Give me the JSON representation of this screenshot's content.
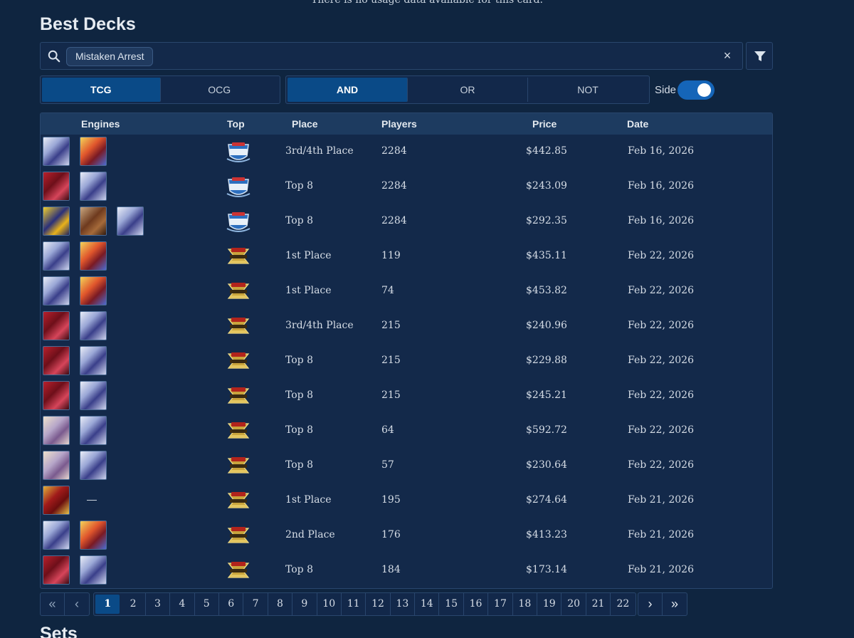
{
  "top_note": "There is no usage data available for this card.",
  "title": "Best Decks",
  "sets_title": "Sets",
  "search": {
    "chip": "Mistaken Arrest",
    "clear_icon": "×"
  },
  "region_tabs": [
    {
      "label": "TCG",
      "active": true
    },
    {
      "label": "OCG",
      "active": false
    }
  ],
  "logic_tabs": [
    {
      "label": "AND",
      "active": true
    },
    {
      "label": "OR",
      "active": false
    },
    {
      "label": "NOT",
      "active": false
    }
  ],
  "side_toggle": {
    "label": "Side",
    "on": true
  },
  "table": {
    "headers": {
      "engines": "Engines",
      "top": "Top",
      "place": "Place",
      "players": "Players",
      "price": "Price",
      "date": "Date"
    },
    "rows": [
      {
        "engines": [
          "white",
          "fire"
        ],
        "badge": "ycs",
        "place": "3rd/4th Place",
        "players": "2284",
        "price": "$442.85",
        "date": "Feb 16, 2026"
      },
      {
        "engines": [
          "red",
          "white"
        ],
        "badge": "ycs",
        "place": "Top 8",
        "players": "2284",
        "price": "$243.09",
        "date": "Feb 16, 2026"
      },
      {
        "engines": [
          "yellow",
          "brown",
          "white"
        ],
        "badge": "ycs",
        "place": "Top 8",
        "players": "2284",
        "price": "$292.35",
        "date": "Feb 16, 2026"
      },
      {
        "engines": [
          "white",
          "fire"
        ],
        "badge": "regional",
        "place": "1st Place",
        "players": "119",
        "price": "$435.11",
        "date": "Feb 22, 2026"
      },
      {
        "engines": [
          "white",
          "fire"
        ],
        "badge": "regional",
        "place": "1st Place",
        "players": "74",
        "price": "$453.82",
        "date": "Feb 22, 2026"
      },
      {
        "engines": [
          "red",
          "white"
        ],
        "badge": "regional",
        "place": "3rd/4th Place",
        "players": "215",
        "price": "$240.96",
        "date": "Feb 22, 2026"
      },
      {
        "engines": [
          "red",
          "white"
        ],
        "badge": "regional",
        "place": "Top 8",
        "players": "215",
        "price": "$229.88",
        "date": "Feb 22, 2026"
      },
      {
        "engines": [
          "red",
          "white"
        ],
        "badge": "regional",
        "place": "Top 8",
        "players": "215",
        "price": "$245.21",
        "date": "Feb 22, 2026"
      },
      {
        "engines": [
          "pale",
          "white"
        ],
        "badge": "regional",
        "place": "Top 8",
        "players": "64",
        "price": "$592.72",
        "date": "Feb 22, 2026"
      },
      {
        "engines": [
          "pale",
          "white"
        ],
        "badge": "regional",
        "place": "Top 8",
        "players": "57",
        "price": "$230.64",
        "date": "Feb 22, 2026"
      },
      {
        "engines": [
          "crimson"
        ],
        "badge": "regional",
        "place": "1st Place",
        "players": "195",
        "price": "$274.64",
        "date": "Feb 21, 2026",
        "dash": "—"
      },
      {
        "engines": [
          "white",
          "fire"
        ],
        "badge": "regional",
        "place": "2nd Place",
        "players": "176",
        "price": "$413.23",
        "date": "Feb 21, 2026"
      },
      {
        "engines": [
          "red",
          "white"
        ],
        "badge": "regional",
        "place": "Top 8",
        "players": "184",
        "price": "$173.14",
        "date": "Feb 21, 2026"
      }
    ]
  },
  "pagination": {
    "first_icon": "«",
    "prev_icon": "‹",
    "next_icon": "›",
    "last_icon": "»",
    "pages": [
      "1",
      "2",
      "3",
      "4",
      "5",
      "6",
      "7",
      "8",
      "9",
      "10",
      "11",
      "12",
      "13",
      "14",
      "15",
      "16",
      "17",
      "18",
      "19",
      "20",
      "21",
      "22"
    ],
    "current": "1"
  },
  "colors": {
    "accent": "#0a4a87",
    "toggle": "#1565b8",
    "background": "#0f2540"
  }
}
